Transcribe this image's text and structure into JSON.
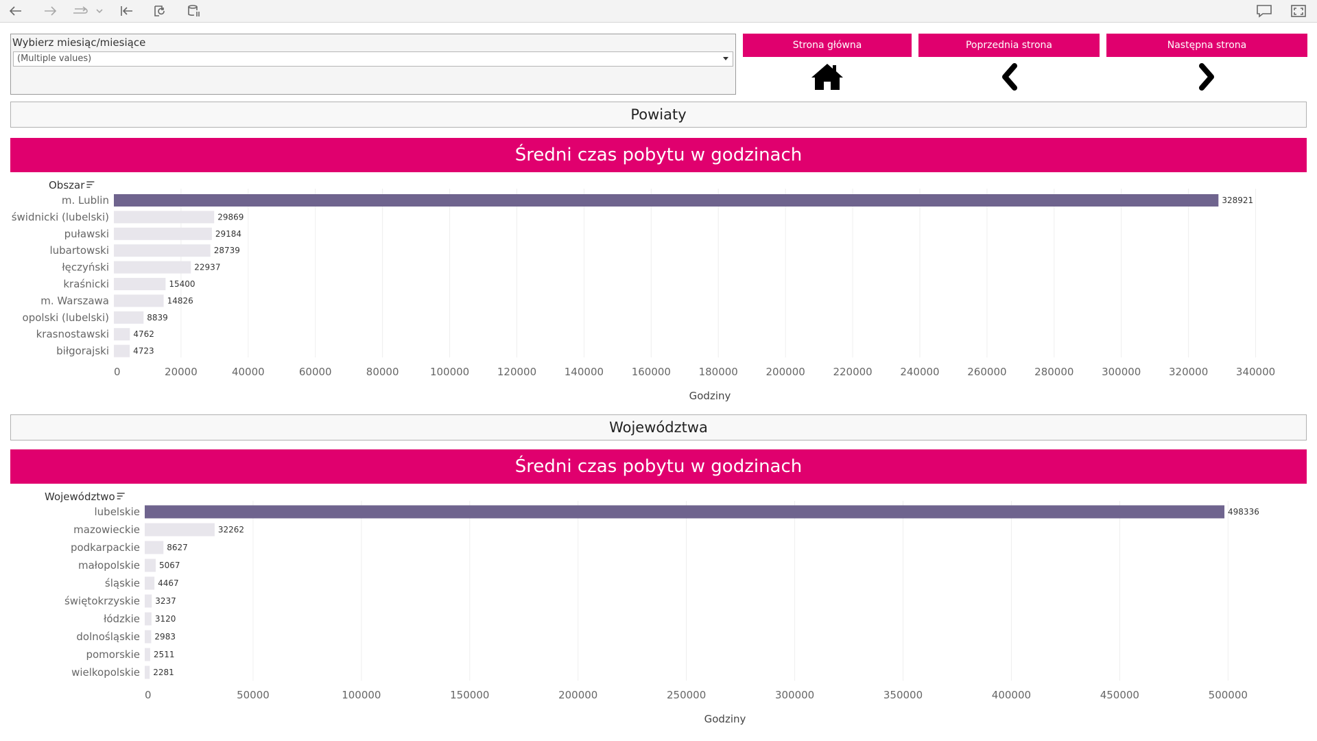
{
  "colors": {
    "accent": "#e0006e",
    "bar_top": "#6f648e",
    "bar_rest": "#e8e6ec"
  },
  "toolbar": {
    "icons": [
      "back-arrow-icon",
      "forward-arrow-icon",
      "redo-icon",
      "chevron-down-icon",
      "revert-to-start-icon",
      "refresh-data-icon",
      "pause-updates-icon",
      "comment-icon",
      "fullscreen-icon"
    ]
  },
  "filter": {
    "title": "Wybierz miesiąc/miesiące",
    "selected": "(Multiple values)"
  },
  "nav": {
    "home_label": "Strona główna",
    "prev_label": "Poprzednia strona",
    "next_label": "Następna strona"
  },
  "sections": {
    "powiaty": "Powiaty",
    "wojewodztwa": "Województwa"
  },
  "chart_data": [
    {
      "type": "bar",
      "orientation": "horizontal",
      "title": "Średni czas pobytu w godzinach",
      "field_title": "Obszar",
      "xlabel": "Godziny",
      "xlim": [
        0,
        355000
      ],
      "grid": true,
      "ticks": [
        "0",
        "20000",
        "40000",
        "60000",
        "80000",
        "100000",
        "120000",
        "140000",
        "160000",
        "180000",
        "200000",
        "220000",
        "240000",
        "260000",
        "280000",
        "300000",
        "320000",
        "340000"
      ],
      "tick_values": [
        0,
        20000,
        40000,
        60000,
        80000,
        100000,
        120000,
        140000,
        160000,
        180000,
        200000,
        220000,
        240000,
        260000,
        280000,
        300000,
        320000,
        340000
      ],
      "categories": [
        "m. Lublin",
        "świdnicki (lubelski)",
        "puławski",
        "lubartowski",
        "łęczyński",
        "kraśnicki",
        "m. Warszawa",
        "opolski (lubelski)",
        "krasnostawski",
        "biłgorajski"
      ],
      "values": [
        328921,
        29869,
        29184,
        28739,
        22937,
        15400,
        14826,
        8839,
        4762,
        4723
      ],
      "value_labels": [
        "328921",
        "29869",
        "29184",
        "28739",
        "22937",
        "15400",
        "14826",
        "8839",
        "4762",
        "4723"
      ]
    },
    {
      "type": "bar",
      "orientation": "horizontal",
      "title": "Średni czas pobytu w godzinach",
      "field_title": "Województwo",
      "xlabel": "Godziny",
      "xlim": [
        0,
        536000
      ],
      "grid": true,
      "ticks": [
        "0",
        "50000",
        "100000",
        "150000",
        "200000",
        "250000",
        "300000",
        "350000",
        "400000",
        "450000",
        "500000"
      ],
      "tick_values": [
        0,
        50000,
        100000,
        150000,
        200000,
        250000,
        300000,
        350000,
        400000,
        450000,
        500000
      ],
      "categories": [
        "lubelskie",
        "mazowieckie",
        "podkarpackie",
        "małopolskie",
        "śląskie",
        "świętokrzyskie",
        "łódzkie",
        "dolnośląskie",
        "pomorskie",
        "wielkopolskie"
      ],
      "values": [
        498336,
        32262,
        8627,
        5067,
        4467,
        3237,
        3120,
        2983,
        2511,
        2281
      ],
      "value_labels": [
        "498336",
        "32262",
        "8627",
        "5067",
        "4467",
        "3237",
        "3120",
        "2983",
        "2511",
        "2281"
      ]
    }
  ]
}
